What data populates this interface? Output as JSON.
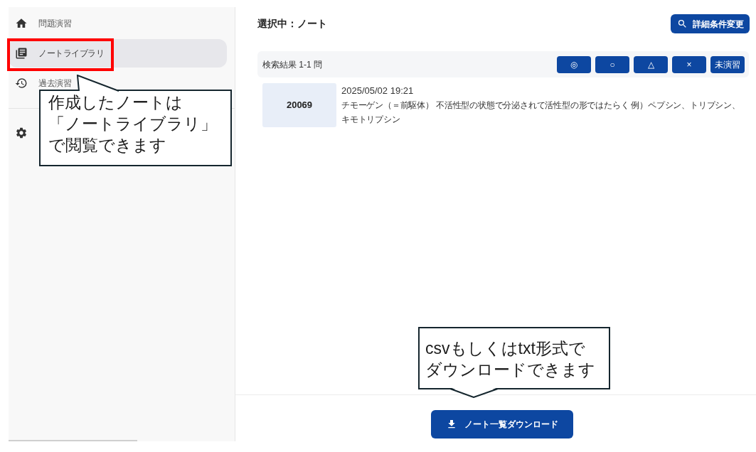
{
  "sidebar": {
    "items": [
      {
        "label": "問題演習",
        "selected": false
      },
      {
        "label": "ノートライブラリ",
        "selected": true
      },
      {
        "label": "過去演習",
        "selected": false
      }
    ]
  },
  "main": {
    "title": "選択中：ノート",
    "detail_button": "詳細条件変更",
    "results": {
      "summary": "検索結果 1-1 問",
      "filters": [
        "◎",
        "○",
        "△",
        "×",
        "未演習"
      ],
      "items": [
        {
          "id": "20069",
          "date": "2025/05/02 19:21",
          "text": "チモーゲン（＝前駆体） 不活性型の状態で分泌されて活性型の形ではたらく 例）ペプシン、トリプシン、キモトリプシン"
        }
      ]
    },
    "download_button": "ノート一覧ダウンロード"
  },
  "annotations": [
    {
      "lines": [
        "作成したノートは",
        "「ノートライブラリ」",
        "で閲覧できます"
      ]
    },
    {
      "lines": [
        "csvもしくはtxt形式で",
        "ダウンロードできます"
      ]
    }
  ]
}
